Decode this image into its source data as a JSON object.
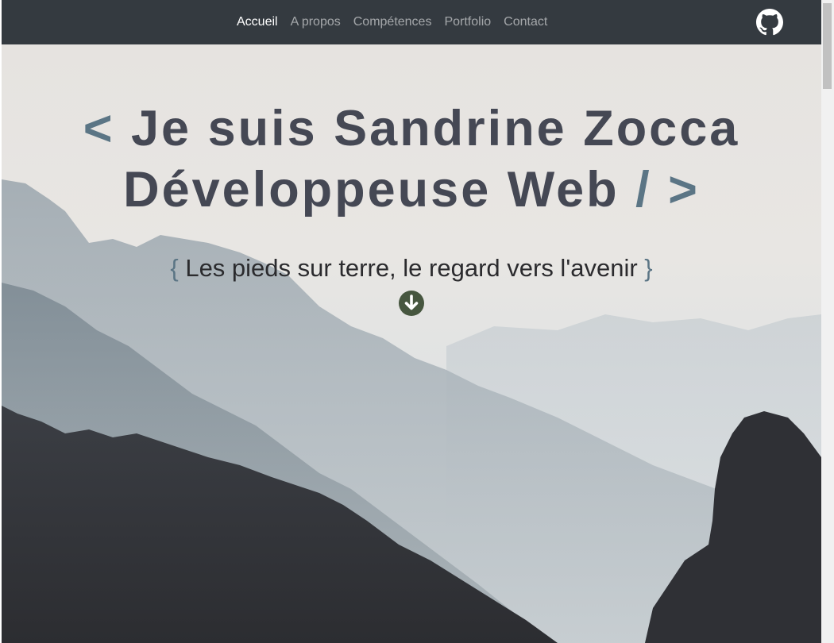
{
  "nav": {
    "items": [
      {
        "label": "Accueil",
        "active": true
      },
      {
        "label": "A propos",
        "active": false
      },
      {
        "label": "Compétences",
        "active": false
      },
      {
        "label": "Portfolio",
        "active": false
      },
      {
        "label": "Contact",
        "active": false
      }
    ],
    "github_icon": "github-icon"
  },
  "hero": {
    "title_open": "<",
    "title_line1": "Je suis Sandrine Zocca",
    "title_line2": "Développeuse Web",
    "title_close": "/ >",
    "subtitle_open_brace": "{",
    "subtitle": "Les pieds sur terre, le regard vers l'avenir",
    "subtitle_close_brace": "}",
    "scroll_icon": "arrow-down-circle-icon"
  },
  "colors": {
    "navbar": "#343a40",
    "title": "#454854",
    "accent": "#5b7585",
    "scroll_button": "#46563f"
  }
}
